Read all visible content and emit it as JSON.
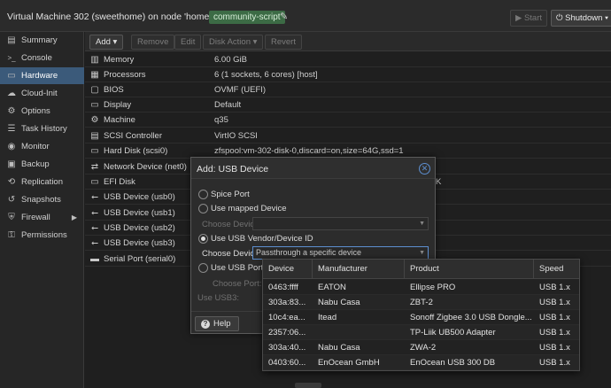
{
  "window": {
    "title": "Virtual Machine 302 (sweethome) on node 'homelab'",
    "tag": "community-script",
    "start_label": "Start",
    "shutdown_label": "Shutdown"
  },
  "sidebar": {
    "items": [
      {
        "label": "Summary",
        "icon": "summary-icon",
        "glyph": "▤"
      },
      {
        "label": "Console",
        "icon": "console-icon",
        "glyph": ">_"
      },
      {
        "label": "Hardware",
        "icon": "monitor-icon",
        "glyph": "🖥"
      },
      {
        "label": "Cloud-Init",
        "icon": "cloud-icon",
        "glyph": "☁"
      },
      {
        "label": "Options",
        "icon": "gear-icon",
        "glyph": "⚙"
      },
      {
        "label": "Task History",
        "icon": "list-icon",
        "glyph": "☰"
      },
      {
        "label": "Monitor",
        "icon": "eye-icon",
        "glyph": "◉"
      },
      {
        "label": "Backup",
        "icon": "floppy-icon",
        "glyph": "▣"
      },
      {
        "label": "Replication",
        "icon": "retweet-icon",
        "glyph": "⟲"
      },
      {
        "label": "Snapshots",
        "icon": "history-icon",
        "glyph": "↺"
      },
      {
        "label": "Firewall",
        "icon": "shield-icon",
        "glyph": "⛨"
      },
      {
        "label": "Permissions",
        "icon": "unlock-icon",
        "glyph": "🔓"
      }
    ],
    "active": "Hardware"
  },
  "toolbar": {
    "add": "Add",
    "remove": "Remove",
    "edit": "Edit",
    "disk_action": "Disk Action",
    "revert": "Revert"
  },
  "hardware": [
    {
      "key": "Memory",
      "value": "6.00 GiB",
      "icon": "memory-icon",
      "glyph": "▥"
    },
    {
      "key": "Processors",
      "value": "6 (1 sockets, 6 cores) [host]",
      "icon": "cpu-icon",
      "glyph": "▦"
    },
    {
      "key": "BIOS",
      "value": "OVMF (UEFI)",
      "icon": "chip-icon",
      "glyph": "▢"
    },
    {
      "key": "Display",
      "value": "Default",
      "icon": "desktop-icon",
      "glyph": "▭"
    },
    {
      "key": "Machine",
      "value": "q35",
      "icon": "cogs-icon",
      "glyph": "⚙"
    },
    {
      "key": "SCSI Controller",
      "value": "VirtIO SCSI",
      "icon": "database-icon",
      "glyph": "▤"
    },
    {
      "key": "Hard Disk (scsi0)",
      "value": "zfspool:vm-302-disk-0,discard=on,size=64G,ssd=1",
      "icon": "hdd-icon",
      "glyph": "▭"
    },
    {
      "key": "Network Device (net0)",
      "value": "",
      "icon": "network-icon",
      "glyph": "⇄"
    },
    {
      "key": "EFI Disk",
      "value": "K",
      "icon": "hdd-icon",
      "glyph": "▭"
    },
    {
      "key": "USB Device (usb0)",
      "value": "",
      "icon": "usb-icon",
      "glyph": "⭠"
    },
    {
      "key": "USB Device (usb1)",
      "value": "",
      "icon": "usb-icon",
      "glyph": "⭠"
    },
    {
      "key": "USB Device (usb2)",
      "value": "",
      "icon": "usb-icon",
      "glyph": "⭠"
    },
    {
      "key": "USB Device (usb3)",
      "value": "",
      "icon": "usb-icon",
      "glyph": "⭠"
    },
    {
      "key": "Serial Port (serial0)",
      "value": "",
      "icon": "keyboard-icon",
      "glyph": "▬"
    }
  ],
  "dialog": {
    "title": "Add: USB Device",
    "spice_port": "Spice Port",
    "use_mapped": "Use mapped Device",
    "choose_device": "Choose Device:",
    "use_vendor": "Use USB Vendor/Device ID",
    "choose_device_label": "Choose Device:",
    "choose_device_value": "Passthrough a specific device",
    "use_port": "Use USB Port",
    "choose_port": "Choose Port:",
    "use_usb3": "Use USB3:",
    "help": "Help"
  },
  "device_grid": {
    "columns": [
      "Device",
      "Manufacturer",
      "Product",
      "Speed"
    ],
    "rows": [
      [
        "0463:ffff",
        "EATON",
        "Ellipse PRO",
        "USB 1.x"
      ],
      [
        "303a:83...",
        "Nabu Casa",
        "ZBT-2",
        "USB 1.x"
      ],
      [
        "10c4:ea...",
        "Itead",
        "Sonoff Zigbee 3.0 USB Dongle...",
        "USB 1.x"
      ],
      [
        "2357:06...",
        "",
        "TP-Liik UB500 Adapter",
        "USB 1.x"
      ],
      [
        "303a:40...",
        "Nabu Casa",
        "ZWA-2",
        "USB 1.x"
      ],
      [
        "0403:60...",
        "EnOcean GmbH",
        "EnOcean USB 300 DB",
        "USB 1.x"
      ]
    ]
  }
}
